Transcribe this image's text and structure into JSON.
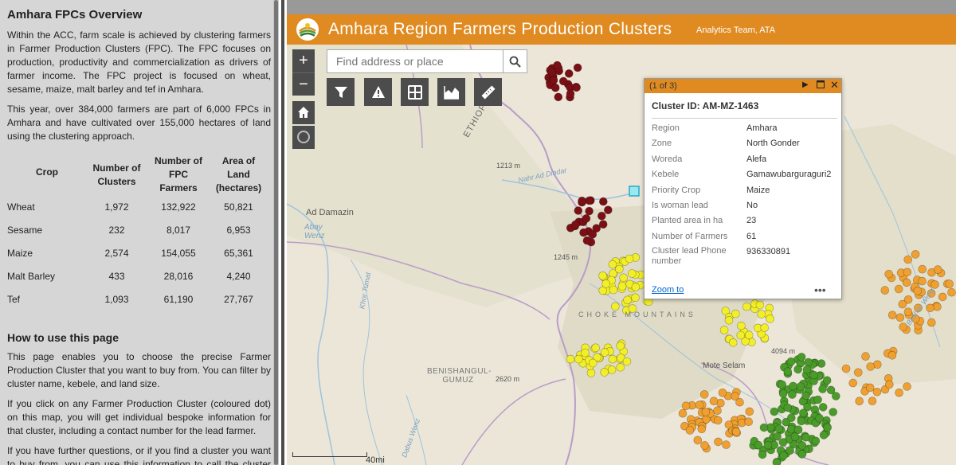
{
  "sidebar": {
    "title": "Amhara FPCs Overview",
    "intro_paragraphs": [
      "Within the ACC, farm scale is achieved by clustering farmers in Farmer Production Clusters (FPC). The FPC focuses on production, productivity and commercialization as drivers of farmer income. The FPC project is focused on wheat, sesame, maize, malt barley and tef in Amhara.",
      "This year, over 384,000 farmers are part of 6,000 FPCs in Amhara and have cultivated over 155,000 hectares of land using the clustering approach."
    ],
    "table": {
      "headers": [
        "Crop",
        "Number of Clusters",
        "Number of FPC Farmers",
        "Area of Land (hectares)"
      ],
      "rows": [
        [
          "Wheat",
          "1,972",
          "132,922",
          "50,821"
        ],
        [
          "Sesame",
          "232",
          "8,017",
          "6,953"
        ],
        [
          "Maize",
          "2,574",
          "154,055",
          "65,361"
        ],
        [
          "Malt Barley",
          "433",
          "28,016",
          "4,240"
        ],
        [
          "Tef",
          "1,093",
          "61,190",
          "27,767"
        ]
      ]
    },
    "how_to_title": "How to use this page",
    "how_to_paragraphs": [
      "This page enables you to choose the precise Farmer Production Cluster that you want to buy from. You can filter by cluster name, kebele, and land size.",
      "If you click on any Farmer Production Cluster (coloured dot) on this map, you will get individual bespoke information for that cluster, including a contact number for the lead farmer.",
      "If you have further questions, or if you find a cluster you want to buy from, you can use this information to call the cluster lead"
    ]
  },
  "header": {
    "title": "Amhara Region Farmers Production Clusters",
    "subtitle": "Analytics Team, ATA"
  },
  "map": {
    "zoom_in": "+",
    "zoom_out": "−",
    "search_placeholder": "Find address or place",
    "labels": {
      "ethiopia": "ETHIOPIA",
      "ad_damazin": "Ad Damazin",
      "abay_wenz": "Abay\nWenz",
      "elev_1213": "1213 m",
      "nahr_ad_dindar": "Nahr Ad Dindar",
      "elev_1245": "1245 m",
      "khor_tumat": "Khor Tumat",
      "choke_mountains": "CHOKE MOUNTAINS",
      "benishangul": "BENISHANGUL-GUMUZ",
      "elev_2620": "2620 m",
      "elev_4094": "4094 m",
      "mote_selam": "Mote Selam",
      "dabus_wenz": "Dabus Wenz",
      "beshilo_wenz": "Beshilo Wenz",
      "scale_label": "40mi"
    },
    "colors": {
      "wheat": "#4a9b2a",
      "sesame": "#7a1016",
      "maize": "#f2ee2a",
      "malt_barley": "#f0a030",
      "tef": "#f0a030"
    }
  },
  "popup": {
    "counter": "(1 of 3)",
    "title": "Cluster ID: AM-MZ-1463",
    "fields": [
      {
        "key": "Region",
        "value": "Amhara"
      },
      {
        "key": "Zone",
        "value": "North Gonder"
      },
      {
        "key": "Woreda",
        "value": "Alefa"
      },
      {
        "key": "Kebele",
        "value": "Gamawubarguraguri2"
      },
      {
        "key": "Priority Crop",
        "value": "Maize"
      },
      {
        "key": "Is woman lead",
        "value": "No"
      },
      {
        "key": "Planted area in ha",
        "value": "23"
      },
      {
        "key": "Number of Farmers",
        "value": "61"
      },
      {
        "key": "Cluster lead Phone number",
        "value": "936330891"
      }
    ],
    "zoom_to": "Zoom to",
    "more": "•••"
  }
}
